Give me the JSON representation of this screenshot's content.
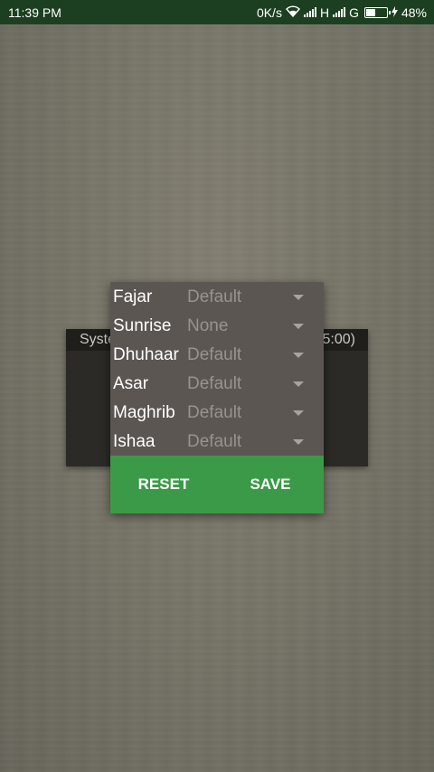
{
  "status_bar": {
    "time": "11:39 PM",
    "speed": "0K/s",
    "network_h": "H",
    "network_g": "G",
    "battery_percent_text": "48%",
    "battery_level": 0.48
  },
  "background_card": {
    "title_left": "Syste",
    "title_right": "5:00)"
  },
  "dialog": {
    "rows": [
      {
        "label": "Fajar",
        "value": "Default"
      },
      {
        "label": "Sunrise",
        "value": "None"
      },
      {
        "label": "Dhuhaar",
        "value": "Default"
      },
      {
        "label": "Asar",
        "value": "Default"
      },
      {
        "label": "Maghrib",
        "value": "Default"
      },
      {
        "label": "Ishaa",
        "value": "Default"
      }
    ],
    "reset_label": "RESET",
    "save_label": "SAVE"
  },
  "colors": {
    "status_bar": "#1d3f21",
    "dialog_bg": "#5c5652",
    "footer_green": "#3b9a47"
  }
}
